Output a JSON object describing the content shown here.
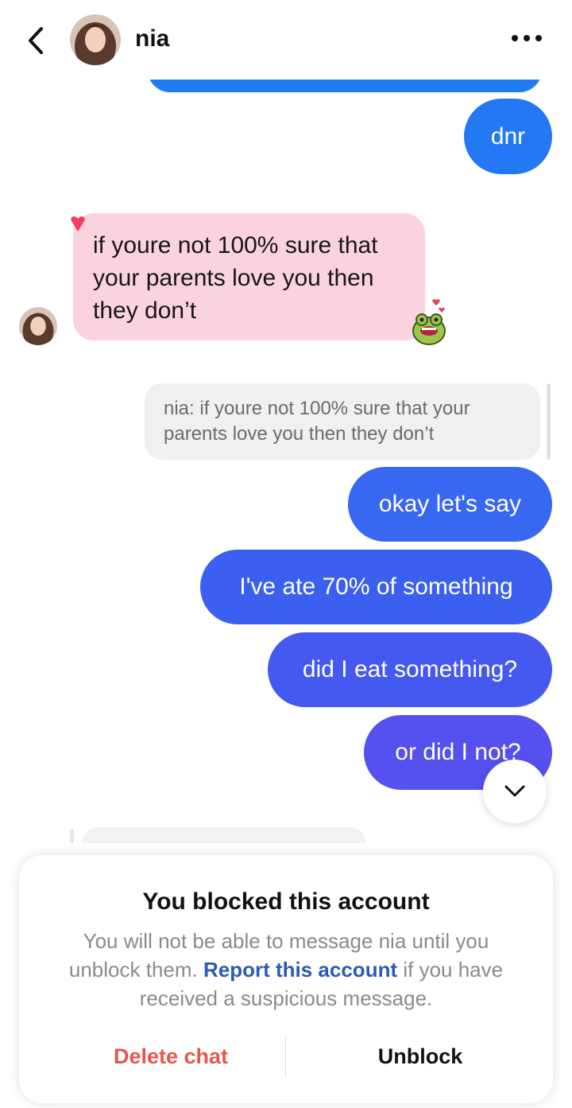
{
  "header": {
    "contact_name": "nia",
    "back_icon": "chevron-left-icon",
    "more_icon": "more-horizontal-icon"
  },
  "messages": {
    "dnr": "dnr",
    "incoming": "if youre not 100% sure that your parents love you then they don’t",
    "reply_quote": "nia: if youre not 100% sure that your parents love you then they don’t",
    "m1": "okay let's say",
    "m2": "I've ate 70% of something",
    "m3": "did I eat something?",
    "m4": "or did I not?"
  },
  "blocked_panel": {
    "title": "You blocked this account",
    "body_pre": "You will not be able to message nia until you unblock them. ",
    "report_link": "Report this account",
    "body_post": " if you have received a suspicious message.",
    "delete_label": "Delete chat",
    "unblock_label": "Unblock"
  },
  "colors": {
    "outgoing_top": "#2478f4",
    "outgoing_bottom": "#5451ee",
    "incoming_bg": "#fbd3df",
    "delete_red": "#e8554a",
    "link_blue": "#2a5bb1"
  }
}
